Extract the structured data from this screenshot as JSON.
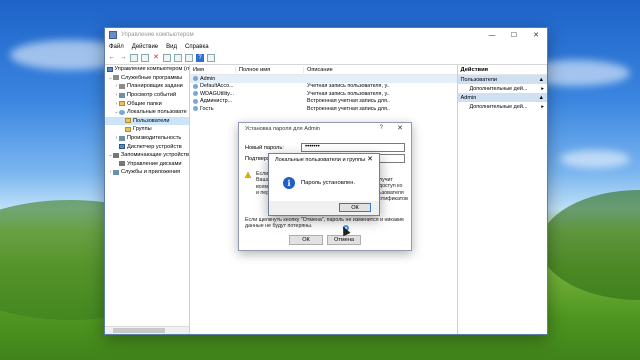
{
  "window": {
    "title": "Управление компьютером",
    "controls": {
      "minimize": "—",
      "maximize": "☐",
      "close": "✕"
    }
  },
  "menu": [
    "Файл",
    "Действие",
    "Вид",
    "Справка"
  ],
  "toolbar": {
    "back": "←",
    "forward": "→",
    "delete": "✕",
    "help": "?"
  },
  "tree": [
    {
      "label": "Управление компьютером (л",
      "arrow": ""
    },
    {
      "label": "Служебные программы",
      "arrow": "⌄"
    },
    {
      "label": "Планировщик задани",
      "arrow": "›"
    },
    {
      "label": "Просмотр событий",
      "arrow": "›"
    },
    {
      "label": "Общие папки",
      "arrow": "›"
    },
    {
      "label": "Локальные пользовате",
      "arrow": "⌄"
    },
    {
      "label": "Пользователи",
      "arrow": ""
    },
    {
      "label": "Группы",
      "arrow": ""
    },
    {
      "label": "Производительность",
      "arrow": "›"
    },
    {
      "label": "Диспетчер устройств",
      "arrow": ""
    },
    {
      "label": "Запоминающие устройств",
      "arrow": "⌄"
    },
    {
      "label": "Управление дисками",
      "arrow": ""
    },
    {
      "label": "Службы и приложения",
      "arrow": "›"
    }
  ],
  "list": {
    "headers": [
      "Имя",
      "Полное имя",
      "Описание"
    ],
    "rows": [
      {
        "name": "Admin",
        "full": "",
        "desc": ""
      },
      {
        "name": "DefaultAcco...",
        "full": "",
        "desc": "Учетная запись пользователя, у..."
      },
      {
        "name": "WDAGUtility...",
        "full": "",
        "desc": "Учетная запись пользователя, у..."
      },
      {
        "name": "Администр...",
        "full": "",
        "desc": "Встроенная учетная запись для..."
      },
      {
        "name": "Гость",
        "full": "",
        "desc": "Встроенная учетная запись для..."
      }
    ]
  },
  "actions": {
    "header": "Действия",
    "sections": [
      {
        "title": "Пользователи",
        "more": "Дополнительные дей..."
      },
      {
        "title": "Admin",
        "more": "Дополнительные дей..."
      }
    ]
  },
  "password_dialog": {
    "title": "Установка пароля для Admin",
    "help": "?",
    "close": "✕",
    "new_password_label": "Новый пароль:",
    "new_password_value": "•••••••",
    "confirm_label": "Подтверждение:",
    "warning_lines": [
      "Если щ",
      "Ваша",
      "всем с",
      "и персо"
    ],
    "warning_right": [
      "лучит",
      "доступ ко",
      "ьзователя",
      "ртификатов"
    ],
    "bottom_text": [
      "Если щелкнуть кнопку \"Отмена\", пароль не изменится и никакие",
      "данные не будут потеряны."
    ],
    "ok": "ОК",
    "cancel": "Отмена"
  },
  "message_box": {
    "title": "Локальные пользователи и группы",
    "close": "✕",
    "icon": "i",
    "text": "Пароль установлен.",
    "ok": "ОК"
  }
}
